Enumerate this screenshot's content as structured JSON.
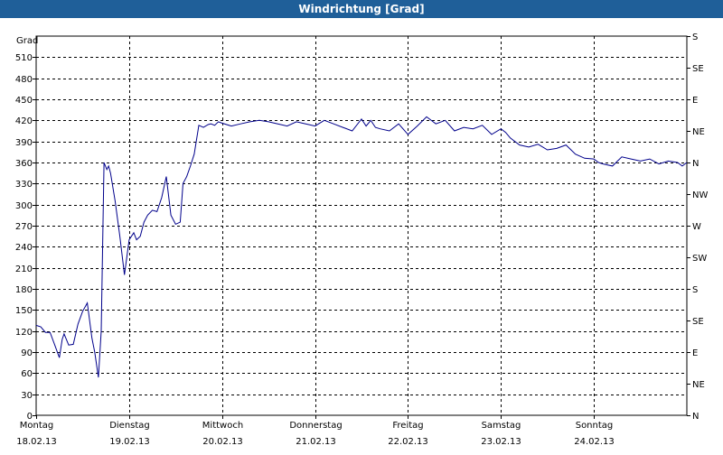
{
  "header": {
    "title": "Windrichtung [Grad]"
  },
  "colors": {
    "titlebar": "#1f5f99",
    "line": "#00008b",
    "grid": "#000000"
  },
  "chart_data": {
    "type": "line",
    "title": "Windrichtung [Grad]",
    "ylabel": "Grad",
    "xlabel": "",
    "ylim": [
      0,
      540
    ],
    "xlim": [
      0,
      7
    ],
    "grid": true,
    "gridline_style": "dashed",
    "y_ticks": [
      0,
      30,
      60,
      90,
      120,
      150,
      180,
      210,
      240,
      270,
      300,
      330,
      360,
      390,
      420,
      450,
      480,
      510
    ],
    "right_axis_labels": [
      {
        "value": 0,
        "label": "N"
      },
      {
        "value": 45,
        "label": "NE"
      },
      {
        "value": 90,
        "label": "E"
      },
      {
        "value": 135,
        "label": "SE"
      },
      {
        "value": 180,
        "label": "S"
      },
      {
        "value": 225,
        "label": "SW"
      },
      {
        "value": 270,
        "label": "W"
      },
      {
        "value": 315,
        "label": "NW"
      },
      {
        "value": 360,
        "label": "N"
      },
      {
        "value": 405,
        "label": "NE"
      },
      {
        "value": 450,
        "label": "E"
      },
      {
        "value": 495,
        "label": "SE"
      },
      {
        "value": 540,
        "label": "S"
      }
    ],
    "x_ticks": [
      {
        "value": 0,
        "day": "Montag",
        "date": "18.02.13"
      },
      {
        "value": 1,
        "day": "Dienstag",
        "date": "19.02.13"
      },
      {
        "value": 2,
        "day": "Mittwoch",
        "date": "20.02.13"
      },
      {
        "value": 3,
        "day": "Donnerstag",
        "date": "21.02.13"
      },
      {
        "value": 4,
        "day": "Freitag",
        "date": "22.02.13"
      },
      {
        "value": 5,
        "day": "Samstag",
        "date": "23.02.13"
      },
      {
        "value": 6,
        "day": "Sonntag",
        "date": "24.02.13"
      }
    ],
    "series": [
      {
        "x": [
          0,
          0.05,
          0.1,
          0.15,
          0.2,
          0.25,
          0.28,
          0.3,
          0.35,
          0.4,
          0.45,
          0.5,
          0.55,
          0.6,
          0.63,
          0.67,
          0.7,
          0.73,
          0.76,
          0.78,
          0.8,
          0.85,
          0.9,
          0.95,
          1.0,
          1.05,
          1.08,
          1.12,
          1.16,
          1.2,
          1.25,
          1.3,
          1.35,
          1.4,
          1.45,
          1.5,
          1.55,
          1.58,
          1.62,
          1.66,
          1.7,
          1.75,
          1.8,
          1.85,
          1.88,
          1.92,
          1.96,
          2.0,
          2.1,
          2.2,
          2.3,
          2.4,
          2.5,
          2.6,
          2.7,
          2.8,
          2.9,
          3.0,
          3.1,
          3.2,
          3.3,
          3.4,
          3.5,
          3.55,
          3.6,
          3.65,
          3.7,
          3.8,
          3.9,
          4.0,
          4.1,
          4.2,
          4.3,
          4.4,
          4.5,
          4.6,
          4.7,
          4.8,
          4.9,
          5.0,
          5.05,
          5.1,
          5.2,
          5.3,
          5.4,
          5.5,
          5.6,
          5.7,
          5.8,
          5.9,
          6.0,
          6.05,
          6.1,
          6.2,
          6.3,
          6.4,
          6.5,
          6.6,
          6.7,
          6.8,
          6.9,
          6.95,
          7.0
        ],
        "y": [
          128,
          126,
          118,
          118,
          100,
          82,
          108,
          116,
          100,
          101,
          130,
          148,
          160,
          110,
          90,
          54,
          120,
          360,
          350,
          355,
          345,
          305,
          255,
          200,
          250,
          260,
          250,
          255,
          275,
          285,
          292,
          290,
          310,
          340,
          285,
          272,
          275,
          330,
          340,
          355,
          372,
          413,
          410,
          414,
          415,
          413,
          418,
          416,
          412,
          415,
          418,
          420,
          418,
          415,
          412,
          418,
          415,
          412,
          420,
          415,
          410,
          405,
          422,
          412,
          420,
          410,
          408,
          405,
          415,
          400,
          412,
          425,
          415,
          420,
          405,
          410,
          408,
          413,
          400,
          408,
          403,
          395,
          385,
          382,
          386,
          378,
          380,
          385,
          372,
          366,
          365,
          360,
          358,
          355,
          368,
          365,
          362,
          365,
          358,
          362,
          360,
          355,
          360
        ]
      }
    ]
  }
}
